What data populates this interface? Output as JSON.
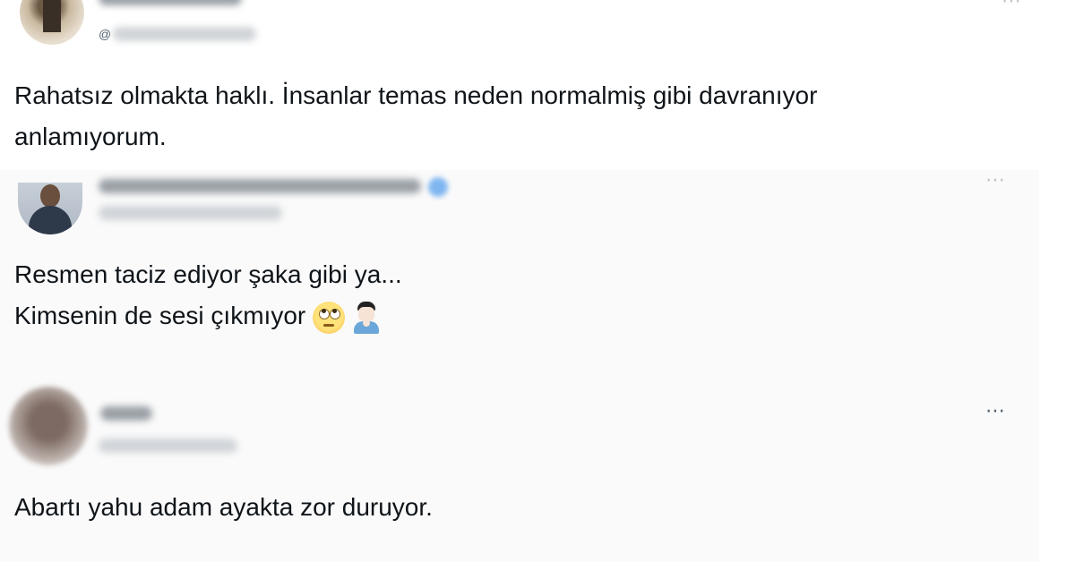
{
  "tweets": [
    {
      "text": "Rahatsız olmakta haklı. İnsanlar temas neden normalmiş gibi davranıyor\nanlamıyorum."
    },
    {
      "line1": "Resmen taciz ediyor şaka gibi ya...",
      "line2": "Kimsenin de sesi çıkmıyor",
      "emojis": [
        "face-with-rolling-eyes",
        "person-facepalming"
      ]
    },
    {
      "text": "Abartı yahu adam ayakta zor duruyor."
    }
  ],
  "icons": {
    "more": "⋯",
    "at": "@"
  }
}
